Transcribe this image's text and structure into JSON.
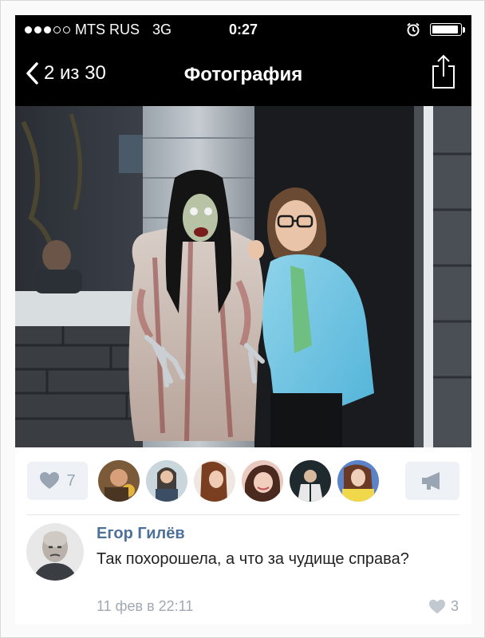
{
  "status_bar": {
    "carrier": "MTS RUS",
    "network": "3G",
    "time": "0:27",
    "signal_bars": 3,
    "signal_total": 5,
    "battery_level": 0.95
  },
  "nav": {
    "back_label": "2 из 30",
    "title": "Фотография"
  },
  "likes": {
    "count": "7"
  },
  "liker_avatars": [
    {
      "name": "liker-avatar-1"
    },
    {
      "name": "liker-avatar-2"
    },
    {
      "name": "liker-avatar-3"
    },
    {
      "name": "liker-avatar-4"
    },
    {
      "name": "liker-avatar-5"
    },
    {
      "name": "liker-avatar-6"
    }
  ],
  "comment": {
    "author": "Егор Гилёв",
    "text": "Так похорошела, а что за чудище справа?",
    "date": "11 фев в 22:11",
    "likes": "3"
  },
  "colors": {
    "bar_bg": "#000000",
    "link": "#4d7198",
    "muted": "#a0a8b2",
    "button_bg": "#eef1f5",
    "button_icon": "#9aa5b3"
  },
  "icons": {
    "back": "chevron-left-icon",
    "share": "share-icon",
    "like": "heart-icon",
    "repost": "megaphone-icon",
    "alarm": "alarm-clock-icon"
  }
}
